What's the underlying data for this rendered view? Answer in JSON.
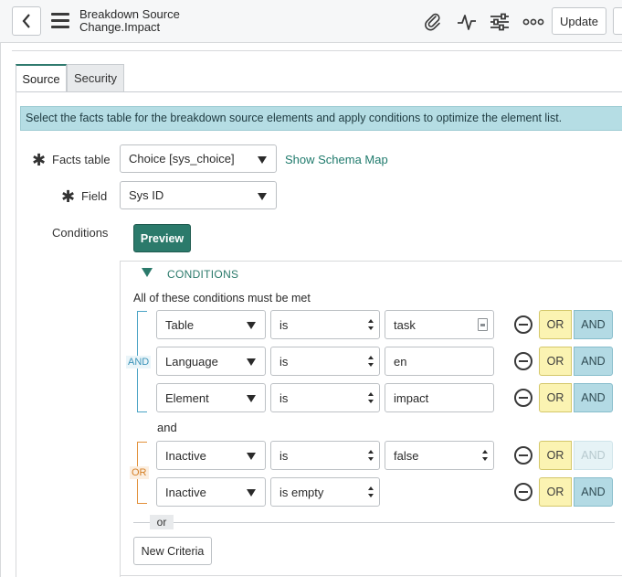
{
  "header": {
    "title_line1": "Breakdown Source",
    "title_line2": "Change.Impact",
    "update_label": "Update",
    "icons": [
      "back-icon",
      "hamburger-icon",
      "paperclip-icon",
      "activity-icon",
      "sliders-icon",
      "more-icon"
    ]
  },
  "tabs": [
    {
      "label": "Source",
      "active": true
    },
    {
      "label": "Security",
      "active": false
    }
  ],
  "info_message": "Select the facts table for the breakdown source elements and apply conditions to optimize the element list.",
  "form": {
    "facts_table": {
      "label": "Facts table",
      "value": "Choice [sys_choice]",
      "required": true
    },
    "schema_link": "Show Schema Map",
    "field": {
      "label": "Field",
      "value": "Sys ID",
      "required": true
    },
    "conditions_label": "Conditions",
    "preview_label": "Preview"
  },
  "conditions": {
    "heading": "CONDITIONS",
    "description": "All of these conditions must be met",
    "group1_label": "AND",
    "group1": [
      {
        "field": "Table",
        "operator": "is",
        "value": "task",
        "value_type": "reference"
      },
      {
        "field": "Language",
        "operator": "is",
        "value": "en",
        "value_type": "text"
      },
      {
        "field": "Element",
        "operator": "is",
        "value": "impact",
        "value_type": "text"
      }
    ],
    "and_separator": "and",
    "group2_label": "OR",
    "group2": [
      {
        "field": "Inactive",
        "operator": "is",
        "value": "false",
        "value_type": "select"
      },
      {
        "field": "Inactive",
        "operator": "is empty",
        "value": "",
        "value_type": "none"
      }
    ],
    "or_button": "OR",
    "and_button": "AND",
    "or_separator": "or",
    "new_criteria": "New Criteria"
  },
  "colors": {
    "accent": "#2b7a6b",
    "info_bg": "#b5dde4",
    "or_bg": "#fbf3b2",
    "and_bg": "#b3dae4",
    "and_bracket": "#4aa3c5",
    "or_bracket": "#e2903a"
  }
}
